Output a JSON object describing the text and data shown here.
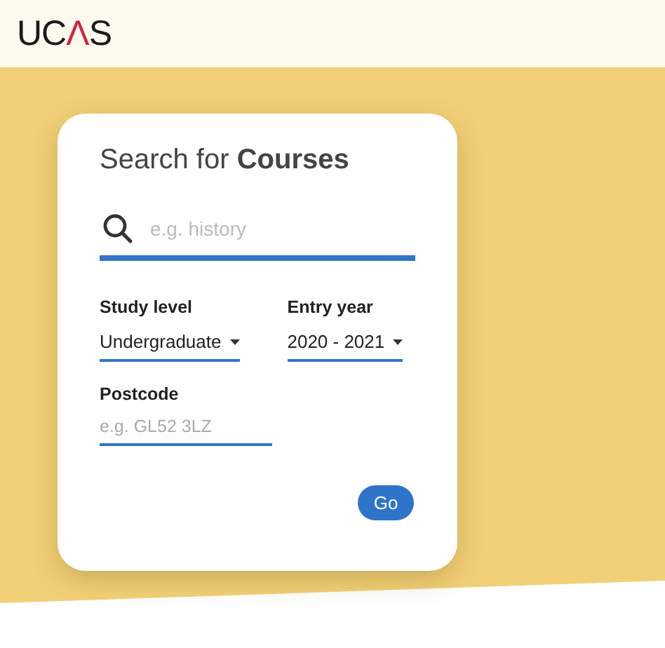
{
  "logo": [
    {
      "text": "UC",
      "accent": false
    },
    {
      "text": "Λ",
      "accent": true
    },
    {
      "text": "S",
      "accent": false
    }
  ],
  "title": "Search for **Courses**",
  "search": {
    "placeholder": "e.g. history"
  },
  "fields": [
    {
      "label": "Study level",
      "kind": "select",
      "value": "Undergraduate"
    },
    {
      "label": "Entry year",
      "kind": "select",
      "value": "2020 - 2021"
    },
    {
      "label": "Postcode",
      "kind": "text",
      "placeholder": "e.g. GL52 3LZ"
    }
  ],
  "button": "Go"
}
